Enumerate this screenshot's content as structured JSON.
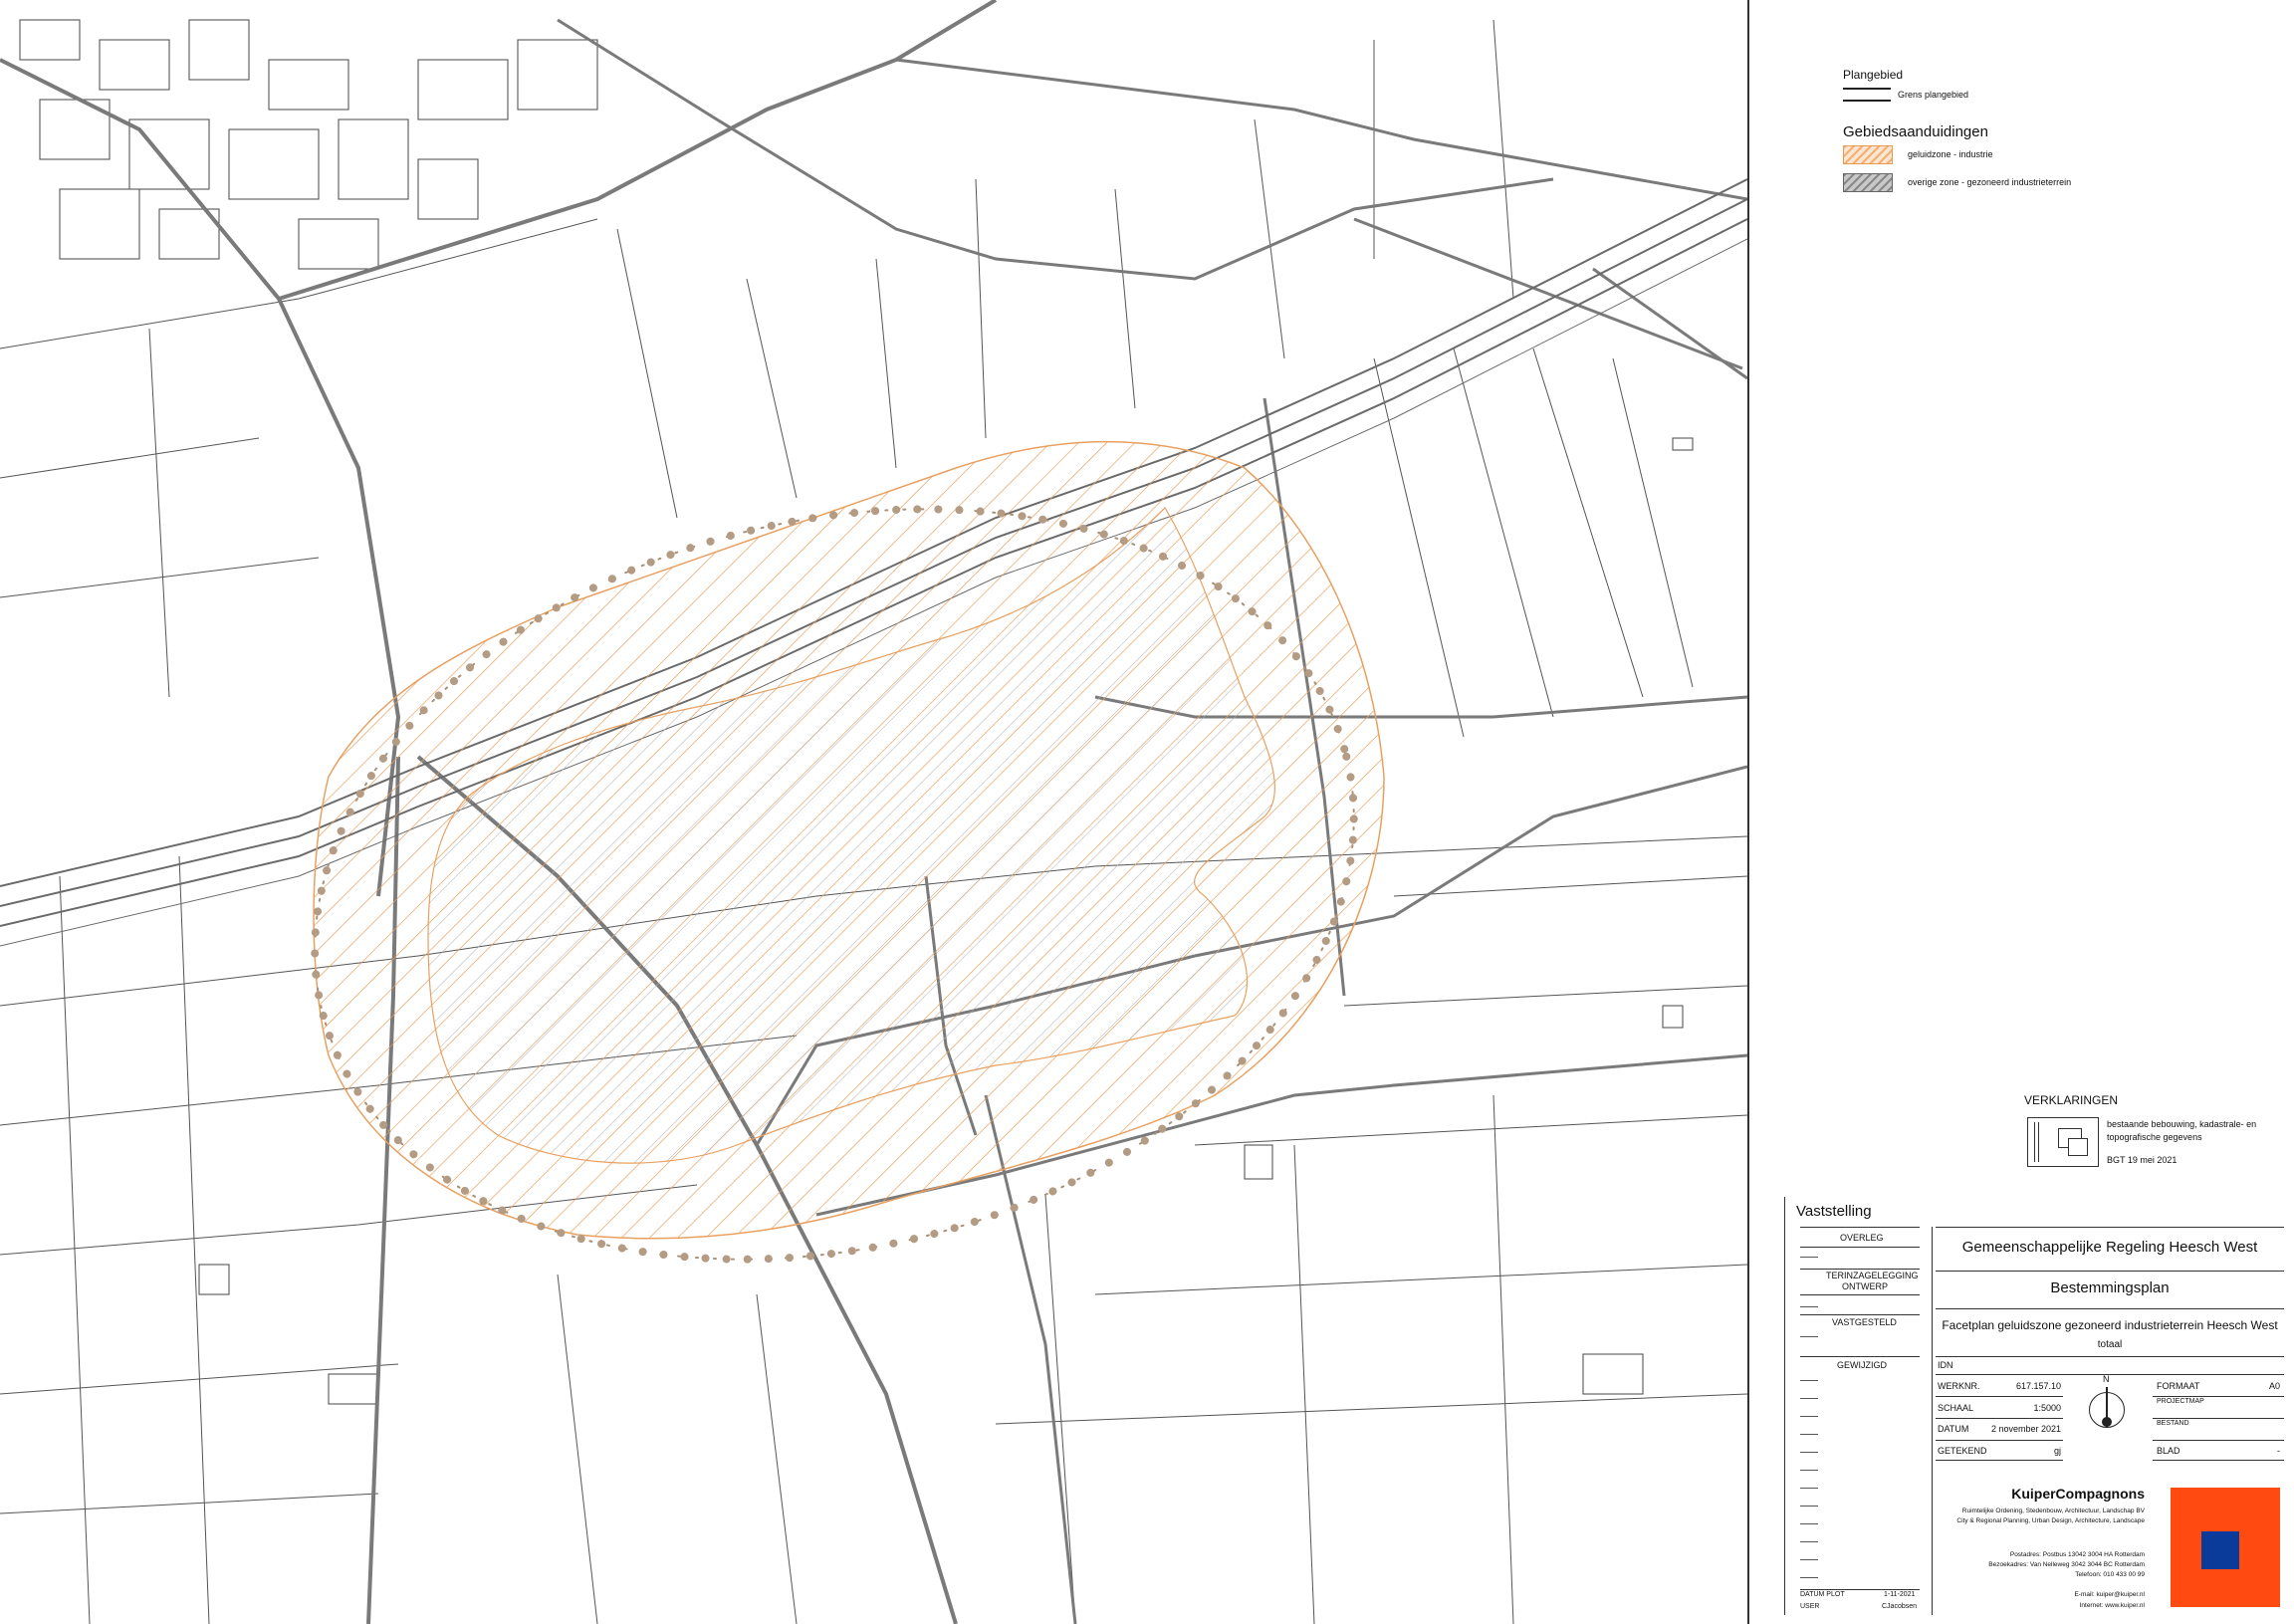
{
  "legend": {
    "plangebied_title": "Plangebied",
    "plangebied_item": "Grens plangebied",
    "gebied_title": "Gebiedsaanduidingen",
    "items": [
      "geluidzone - industrie",
      "overige zone - gezoneerd industrieterrein"
    ]
  },
  "verklaringen": {
    "title": "VERKLARINGEN",
    "line1": "bestaande bebouwing, kadastrale- en",
    "line2": "topografische gegevens",
    "source": "BGT 19 mei 2021"
  },
  "vaststelling": {
    "title": "Vaststelling",
    "rows": [
      "OVERLEG",
      "TERINZAGELEGGING",
      "ONTWERP",
      "VASTGESTELD",
      "GEWIJZIGD"
    ],
    "datum_plot_label": "DATUM PLOT",
    "datum_plot": "1-11-2021",
    "user_label": "USER",
    "user": "CJacobsen"
  },
  "title_block": {
    "client": "Gemeenschappelijke Regeling Heesch West",
    "plan_type": "Bestemmingsplan",
    "plan_name": "Facetplan geluidszone gezoneerd industrieterrein Heesch West",
    "subtitle": "totaal",
    "idn_label": "IDN",
    "werknr_label": "WERKNR.",
    "werknr": "617.157.10",
    "schaal_label": "SCHAAL",
    "schaal": "1:5000",
    "datum_label": "DATUM",
    "datum": "2 november 2021",
    "getekend_label": "GETEKEND",
    "getekend": "gj",
    "north": "N",
    "formaat_label": "FORMAAT",
    "formaat": "A0",
    "projectmap_label": "PROJECTMAP",
    "bestand_label": "BESTAND",
    "blad_label": "BLAD",
    "blad": "-"
  },
  "company": {
    "name": "KuiperCompagnons",
    "line1": "Ruimtelijke Ordening, Stedenbouw, Architectuur, Landschap BV",
    "line2": "City & Regional Planning, Urban Design, Architecture, Landscape",
    "addr1": "Postadres: Postbus 13042  3004 HA Rotterdam",
    "addr2": "Bezoekadres: Van Nelleweg 3042  3044 BC Rotterdam",
    "phone": "Telefoon: 010 433 00 99",
    "email": "E-mail: kuiper@kuiper.nl",
    "web": "Internet: www.kuiper.nl",
    "logo_orange": "#ff4a12",
    "logo_blue": "#0a3a9a"
  },
  "colors": {
    "zone_orange": "#e8a060",
    "zone_gray": "#9a9a9a",
    "roads": "#7a7a7a"
  }
}
